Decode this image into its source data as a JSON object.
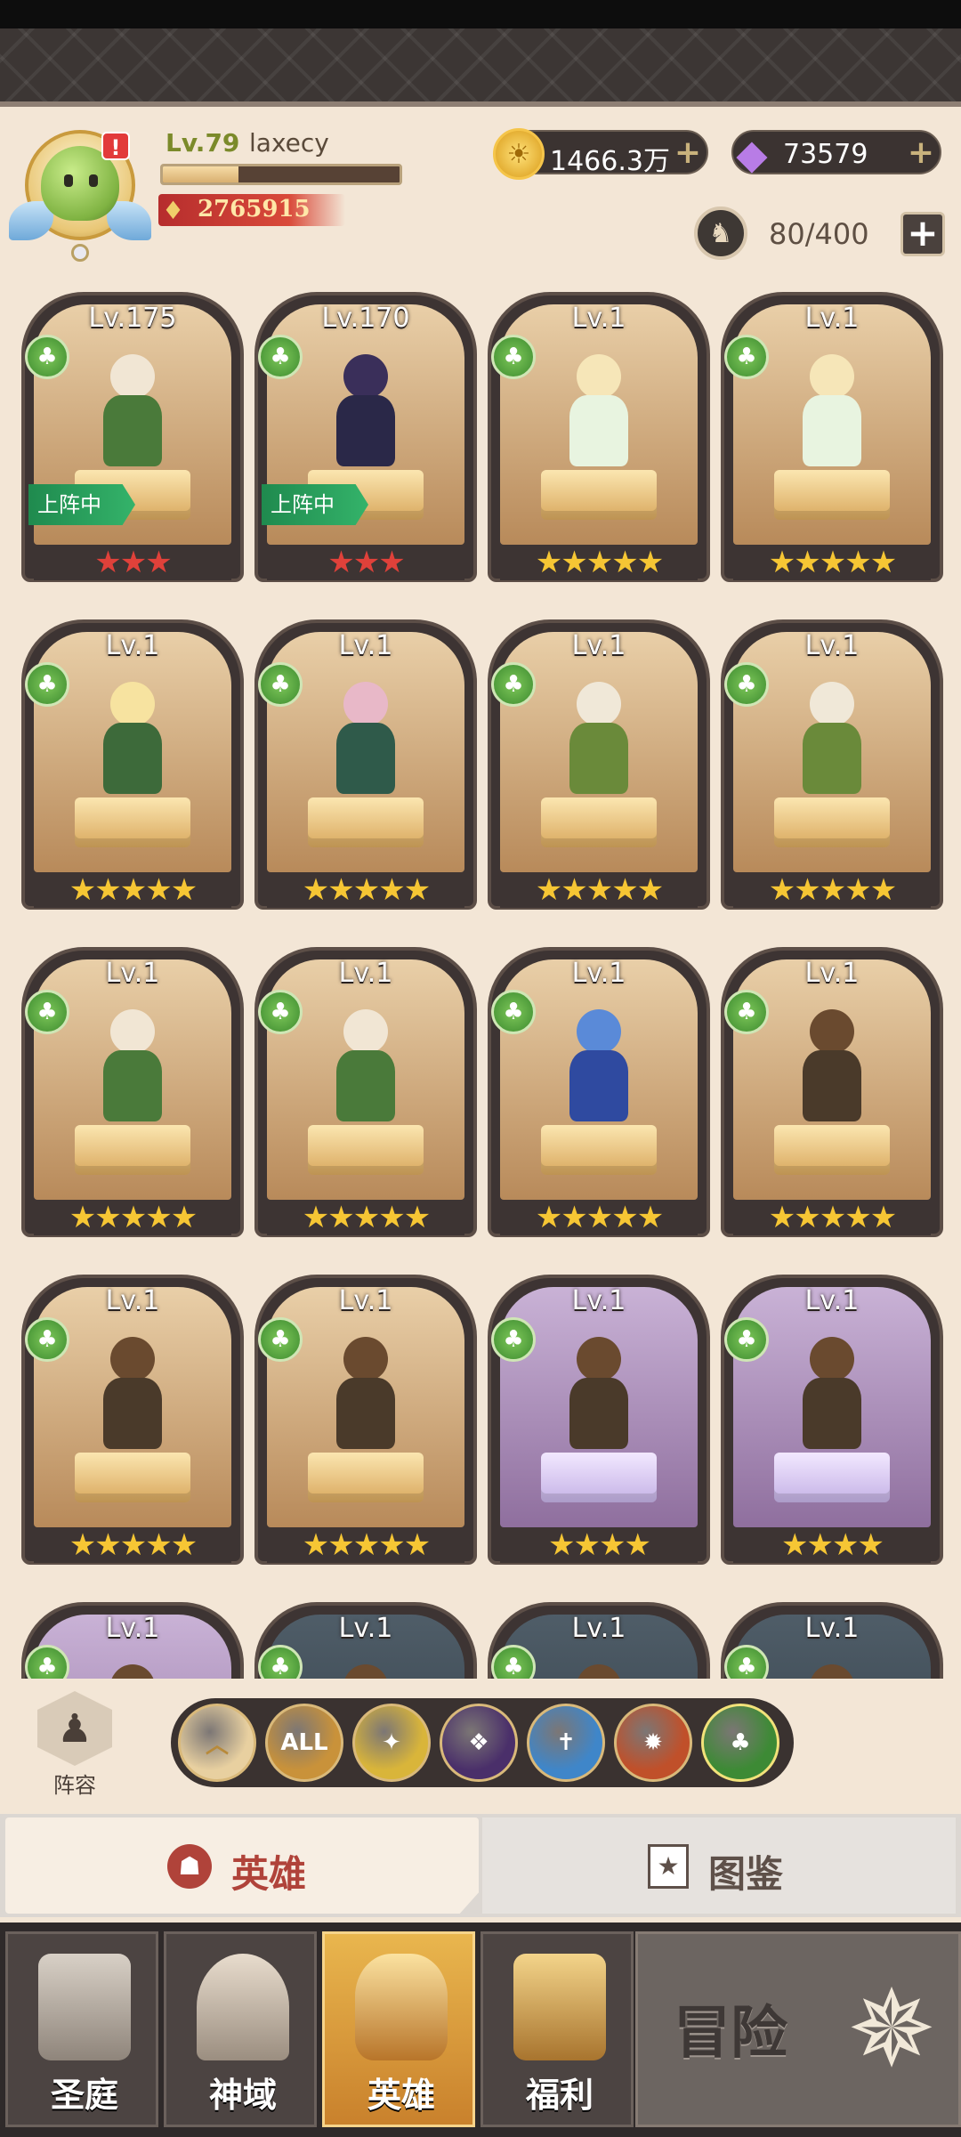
{
  "player": {
    "level": "Lv.79",
    "name": "laxecy",
    "exp_fraction": 0.32,
    "power": "2765915",
    "alert": "!"
  },
  "resources": {
    "gold": "1466.3万",
    "gems": "73579",
    "plus": "+",
    "gold_icon": "sun-coin-icon",
    "gem_icon": "diamond-icon"
  },
  "hero_capacity": {
    "value": "80/400",
    "add": "+"
  },
  "heroes": [
    {
      "level": "Lv.175",
      "stars": "★★★",
      "star_color": "red",
      "deployed": true,
      "theme": "brown"
    },
    {
      "level": "Lv.170",
      "stars": "★★★",
      "star_color": "red",
      "deployed": true,
      "theme": "brown"
    },
    {
      "level": "Lv.1",
      "stars": "★★★★★",
      "star_color": "gold",
      "deployed": false,
      "theme": "brown"
    },
    {
      "level": "Lv.1",
      "stars": "★★★★★",
      "star_color": "gold",
      "deployed": false,
      "theme": "brown"
    },
    {
      "level": "Lv.1",
      "stars": "★★★★★",
      "star_color": "gold",
      "deployed": false,
      "theme": "brown"
    },
    {
      "level": "Lv.1",
      "stars": "★★★★★",
      "star_color": "gold",
      "deployed": false,
      "theme": "brown"
    },
    {
      "level": "Lv.1",
      "stars": "★★★★★",
      "star_color": "gold",
      "deployed": false,
      "theme": "brown"
    },
    {
      "level": "Lv.1",
      "stars": "★★★★★",
      "star_color": "gold",
      "deployed": false,
      "theme": "brown"
    },
    {
      "level": "Lv.1",
      "stars": "★★★★★",
      "star_color": "gold",
      "deployed": false,
      "theme": "brown"
    },
    {
      "level": "Lv.1",
      "stars": "★★★★★",
      "star_color": "gold",
      "deployed": false,
      "theme": "brown"
    },
    {
      "level": "Lv.1",
      "stars": "★★★★★",
      "star_color": "gold",
      "deployed": false,
      "theme": "brown"
    },
    {
      "level": "Lv.1",
      "stars": "★★★★★",
      "star_color": "gold",
      "deployed": false,
      "theme": "brown"
    },
    {
      "level": "Lv.1",
      "stars": "★★★★★",
      "star_color": "gold",
      "deployed": false,
      "theme": "brown"
    },
    {
      "level": "Lv.1",
      "stars": "★★★★★",
      "star_color": "gold",
      "deployed": false,
      "theme": "brown"
    },
    {
      "level": "Lv.1",
      "stars": "★★★★",
      "star_color": "gold",
      "deployed": false,
      "theme": "purple"
    },
    {
      "level": "Lv.1",
      "stars": "★★★★",
      "star_color": "gold",
      "deployed": false,
      "theme": "purple"
    },
    {
      "level": "Lv.1",
      "stars": "",
      "star_color": "gold",
      "deployed": false,
      "theme": "purple"
    },
    {
      "level": "Lv.1",
      "stars": "",
      "star_color": "gold",
      "deployed": false,
      "theme": "dark"
    },
    {
      "level": "Lv.1",
      "stars": "",
      "star_color": "gold",
      "deployed": false,
      "theme": "dark"
    },
    {
      "level": "Lv.1",
      "stars": "",
      "star_color": "gold",
      "deployed": false,
      "theme": "dark"
    }
  ],
  "deploy_label": "上阵中",
  "lineup": {
    "label": "阵容",
    "icon": "chess-pawn-icon"
  },
  "filters": [
    {
      "name": "filter-up",
      "label": "︿",
      "color": "#e8d0a0"
    },
    {
      "name": "filter-all",
      "label": "ALL",
      "color": "#c9923a"
    },
    {
      "name": "filter-light",
      "label": "✦",
      "color": "#d9b53a"
    },
    {
      "name": "filter-dark",
      "label": "❖",
      "color": "#4a2f6a"
    },
    {
      "name": "filter-sword",
      "label": "✝",
      "color": "#3f86c9"
    },
    {
      "name": "filter-wolf",
      "label": "✹",
      "color": "#c0502a"
    },
    {
      "name": "filter-nature",
      "label": "♣",
      "color": "#3d8a35"
    }
  ],
  "tabs": {
    "heroes": "英雄",
    "codex": "图鉴",
    "heroes_icon": "helmet-icon",
    "codex_icon": "star-book-icon"
  },
  "nav": [
    {
      "label": "圣庭",
      "icon": "castle-icon",
      "color": "#b9b0a6"
    },
    {
      "label": "神域",
      "icon": "crystal-arch-icon",
      "color": "#b9aca0"
    },
    {
      "label": "英雄",
      "icon": "horned-helmet-icon",
      "color": "#d99b3a"
    },
    {
      "label": "福利",
      "icon": "treasure-chest-icon",
      "color": "#d0a652"
    }
  ],
  "adventure": {
    "label": "冒险",
    "icon": "compass-icon"
  }
}
